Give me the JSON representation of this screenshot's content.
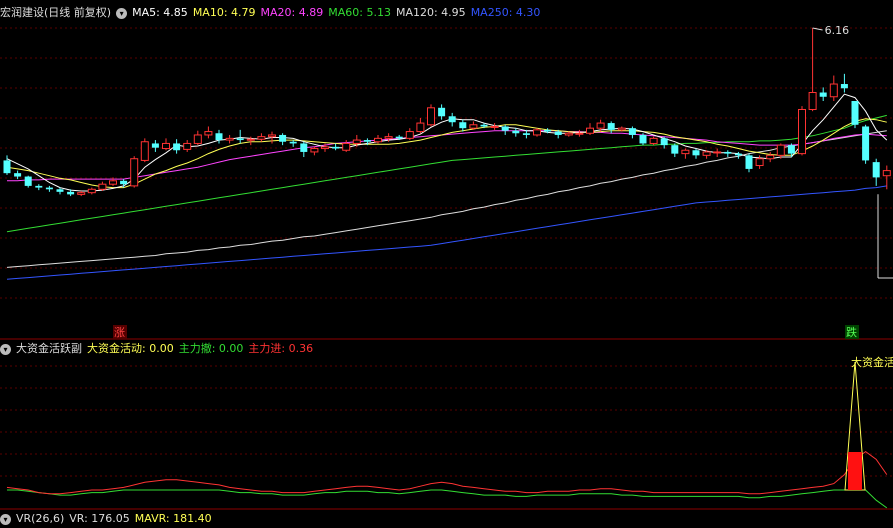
{
  "main_panel": {
    "title": "宏润建设(日线 前复权)",
    "ma_labels": [
      {
        "key": "ma5",
        "text": "MA5: 4.85",
        "color": "#ffffff"
      },
      {
        "key": "ma10",
        "text": "MA10: 4.79",
        "color": "#ffff55"
      },
      {
        "key": "ma20",
        "text": "MA20: 4.89",
        "color": "#ff44ff"
      },
      {
        "key": "ma60",
        "text": "MA60: 5.13",
        "color": "#33dd33"
      },
      {
        "key": "ma120",
        "text": "MA120: 4.95",
        "color": "#dddddd"
      },
      {
        "key": "ma250",
        "text": "MA250: 4.30",
        "color": "#3355ff"
      }
    ],
    "high_marker": "6.16",
    "rise_tag": "涨",
    "fall_tag": "跌"
  },
  "indicator_panel": {
    "title": "大资金活跃副",
    "labels": [
      {
        "key": "active",
        "text": "大资金活动: 0.00",
        "color": "#ffff55"
      },
      {
        "key": "disperse",
        "text": "主力撤: 0.00",
        "color": "#33dd33"
      },
      {
        "key": "enter",
        "text": "主力进: 0.36",
        "color": "#ff3333"
      }
    ],
    "peak_label": "大资金活动"
  },
  "vr_panel": {
    "title": "VR(26,6)",
    "labels": [
      {
        "key": "vr",
        "text": "VR: 176.05",
        "color": "#dddddd"
      },
      {
        "key": "mavr",
        "text": "MAVR: 181.40",
        "color": "#ffff55"
      }
    ]
  },
  "chart_data": {
    "type": "candlestick",
    "title": "宏润建设(日线 前复权)",
    "max_price_marked": 6.16,
    "candles": [
      [
        4.6,
        4.45,
        4.66,
        4.43
      ],
      [
        4.45,
        4.41,
        4.48,
        4.38
      ],
      [
        4.41,
        4.3,
        4.42,
        4.28
      ],
      [
        4.3,
        4.28,
        4.32,
        4.25
      ],
      [
        4.28,
        4.26,
        4.3,
        4.23
      ],
      [
        4.26,
        4.23,
        4.28,
        4.2
      ],
      [
        4.23,
        4.2,
        4.26,
        4.18
      ],
      [
        4.2,
        4.22,
        4.24,
        4.18
      ],
      [
        4.22,
        4.26,
        4.28,
        4.2
      ],
      [
        4.26,
        4.32,
        4.35,
        4.24
      ],
      [
        4.32,
        4.36,
        4.4,
        4.3
      ],
      [
        4.36,
        4.32,
        4.38,
        4.28
      ],
      [
        4.3,
        4.62,
        4.65,
        4.28
      ],
      [
        4.6,
        4.82,
        4.86,
        4.58
      ],
      [
        4.8,
        4.75,
        4.84,
        4.7
      ],
      [
        4.74,
        4.8,
        4.86,
        4.72
      ],
      [
        4.8,
        4.72,
        4.85,
        4.68
      ],
      [
        4.73,
        4.8,
        4.84,
        4.7
      ],
      [
        4.8,
        4.9,
        4.95,
        4.78
      ],
      [
        4.9,
        4.94,
        5.0,
        4.86
      ],
      [
        4.92,
        4.84,
        4.96,
        4.8
      ],
      [
        4.84,
        4.86,
        4.9,
        4.8
      ],
      [
        4.86,
        4.84,
        4.96,
        4.8
      ],
      [
        4.84,
        4.85,
        4.88,
        4.78
      ],
      [
        4.85,
        4.88,
        4.92,
        4.82
      ],
      [
        4.88,
        4.9,
        4.94,
        4.8
      ],
      [
        4.9,
        4.82,
        4.92,
        4.78
      ],
      [
        4.82,
        4.8,
        4.84,
        4.76
      ],
      [
        4.8,
        4.7,
        4.82,
        4.64
      ],
      [
        4.7,
        4.74,
        4.76,
        4.66
      ],
      [
        4.74,
        4.76,
        4.8,
        4.7
      ],
      [
        4.76,
        4.74,
        4.8,
        4.72
      ],
      [
        4.72,
        4.8,
        4.84,
        4.7
      ],
      [
        4.8,
        4.84,
        4.9,
        4.76
      ],
      [
        4.84,
        4.82,
        4.86,
        4.78
      ],
      [
        4.82,
        4.86,
        4.9,
        4.8
      ],
      [
        4.86,
        4.88,
        4.92,
        4.82
      ],
      [
        4.88,
        4.86,
        4.9,
        4.84
      ],
      [
        4.86,
        4.94,
        4.98,
        4.84
      ],
      [
        4.94,
        5.04,
        5.1,
        4.92
      ],
      [
        5.02,
        5.22,
        5.26,
        5.0
      ],
      [
        5.22,
        5.12,
        5.26,
        5.08
      ],
      [
        5.12,
        5.05,
        5.16,
        5.0
      ],
      [
        5.05,
        4.98,
        5.08,
        4.94
      ],
      [
        4.98,
        5.02,
        5.06,
        4.96
      ],
      [
        5.02,
        5.0,
        5.04,
        4.98
      ],
      [
        5.0,
        5.0,
        5.04,
        4.96
      ],
      [
        5.0,
        4.95,
        5.02,
        4.9
      ],
      [
        4.95,
        4.92,
        4.98,
        4.88
      ],
      [
        4.92,
        4.9,
        4.96,
        4.86
      ],
      [
        4.9,
        4.96,
        4.98,
        4.88
      ],
      [
        4.96,
        4.94,
        4.98,
        4.92
      ],
      [
        4.94,
        4.9,
        4.96,
        4.86
      ],
      [
        4.9,
        4.92,
        4.94,
        4.88
      ],
      [
        4.92,
        4.92,
        4.96,
        4.88
      ],
      [
        4.92,
        4.98,
        5.04,
        4.9
      ],
      [
        4.98,
        5.04,
        5.08,
        4.94
      ],
      [
        5.04,
        4.96,
        5.06,
        4.92
      ],
      [
        4.96,
        4.98,
        5.0,
        4.94
      ],
      [
        4.98,
        4.9,
        5.0,
        4.86
      ],
      [
        4.9,
        4.8,
        4.92,
        4.78
      ],
      [
        4.8,
        4.86,
        4.88,
        4.78
      ],
      [
        4.86,
        4.78,
        4.88,
        4.74
      ],
      [
        4.78,
        4.68,
        4.8,
        4.64
      ],
      [
        4.68,
        4.72,
        4.74,
        4.62
      ],
      [
        4.72,
        4.66,
        4.74,
        4.62
      ],
      [
        4.66,
        4.7,
        4.72,
        4.62
      ],
      [
        4.7,
        4.7,
        4.74,
        4.64
      ],
      [
        4.7,
        4.68,
        4.72,
        4.64
      ],
      [
        4.68,
        4.66,
        4.7,
        4.62
      ],
      [
        4.66,
        4.5,
        4.68,
        4.46
      ],
      [
        4.54,
        4.62,
        4.66,
        4.5
      ],
      [
        4.62,
        4.66,
        4.7,
        4.58
      ],
      [
        4.66,
        4.78,
        4.8,
        4.62
      ],
      [
        4.78,
        4.68,
        4.8,
        4.64
      ],
      [
        4.68,
        5.2,
        5.24,
        4.66
      ],
      [
        5.2,
        5.4,
        6.16,
        5.18
      ],
      [
        5.4,
        5.35,
        5.46,
        5.3
      ],
      [
        5.35,
        5.5,
        5.6,
        5.3
      ],
      [
        5.5,
        5.45,
        5.62,
        5.4
      ],
      [
        5.3,
        5.02,
        5.3,
        4.98
      ],
      [
        5.0,
        4.6,
        5.02,
        4.56
      ],
      [
        4.58,
        4.4,
        4.62,
        4.3
      ],
      [
        4.42,
        4.48,
        4.54,
        4.26
      ]
    ],
    "ma5": [
      4.62,
      4.56,
      4.5,
      4.42,
      4.34,
      4.28,
      4.25,
      4.24,
      4.24,
      4.25,
      4.27,
      4.3,
      4.38,
      4.52,
      4.61,
      4.69,
      4.78,
      4.76,
      4.77,
      4.8,
      4.84,
      4.85,
      4.87,
      4.86,
      4.85,
      4.87,
      4.87,
      4.86,
      4.82,
      4.79,
      4.76,
      4.75,
      4.75,
      4.78,
      4.8,
      4.82,
      4.84,
      4.85,
      4.87,
      4.91,
      4.99,
      5.05,
      5.09,
      5.08,
      5.08,
      5.04,
      5.01,
      4.99,
      4.98,
      4.95,
      4.95,
      4.93,
      4.92,
      4.92,
      4.93,
      4.94,
      4.96,
      4.97,
      4.98,
      4.97,
      4.94,
      4.9,
      4.86,
      4.82,
      4.77,
      4.74,
      4.71,
      4.69,
      4.69,
      4.68,
      4.64,
      4.63,
      4.62,
      4.64,
      4.64,
      4.79,
      4.95,
      5.08,
      5.23,
      5.38,
      5.34,
      5.18,
      4.96,
      4.84
    ],
    "ma10": [
      4.52,
      4.5,
      4.48,
      4.45,
      4.42,
      4.39,
      4.37,
      4.34,
      4.31,
      4.29,
      4.28,
      4.28,
      4.32,
      4.38,
      4.44,
      4.48,
      4.53,
      4.57,
      4.62,
      4.68,
      4.73,
      4.77,
      4.8,
      4.82,
      4.82,
      4.83,
      4.84,
      4.84,
      4.83,
      4.82,
      4.81,
      4.8,
      4.79,
      4.79,
      4.79,
      4.79,
      4.79,
      4.8,
      4.82,
      4.84,
      4.87,
      4.9,
      4.93,
      4.95,
      4.97,
      4.99,
      5.0,
      5.02,
      5.02,
      5.0,
      4.98,
      4.96,
      4.95,
      4.94,
      4.93,
      4.93,
      4.94,
      4.95,
      4.95,
      4.95,
      4.94,
      4.93,
      4.91,
      4.88,
      4.86,
      4.84,
      4.82,
      4.79,
      4.77,
      4.74,
      4.71,
      4.69,
      4.67,
      4.66,
      4.66,
      4.71,
      4.77,
      4.84,
      4.92,
      5.0,
      5.06,
      5.09,
      5.08,
      5.05
    ],
    "ma20": [
      4.36,
      4.36,
      4.37,
      4.37,
      4.38,
      4.38,
      4.38,
      4.38,
      4.38,
      4.38,
      4.38,
      4.38,
      4.4,
      4.42,
      4.44,
      4.46,
      4.48,
      4.5,
      4.52,
      4.55,
      4.58,
      4.61,
      4.63,
      4.65,
      4.67,
      4.69,
      4.71,
      4.73,
      4.75,
      4.76,
      4.78,
      4.8,
      4.81,
      4.82,
      4.83,
      4.84,
      4.85,
      4.86,
      4.87,
      4.88,
      4.89,
      4.9,
      4.91,
      4.92,
      4.93,
      4.94,
      4.95,
      4.95,
      4.95,
      4.95,
      4.95,
      4.95,
      4.95,
      4.94,
      4.94,
      4.93,
      4.93,
      4.92,
      4.92,
      4.91,
      4.9,
      4.89,
      4.88,
      4.87,
      4.86,
      4.85,
      4.84,
      4.82,
      4.81,
      4.8,
      4.79,
      4.78,
      4.78,
      4.78,
      4.78,
      4.79,
      4.81,
      4.83,
      4.86,
      4.88,
      4.9,
      4.91,
      4.9,
      4.89
    ],
    "ma60": [
      3.76,
      3.78,
      3.8,
      3.82,
      3.84,
      3.86,
      3.88,
      3.9,
      3.92,
      3.94,
      3.96,
      3.98,
      4.0,
      4.02,
      4.04,
      4.06,
      4.08,
      4.1,
      4.12,
      4.14,
      4.16,
      4.18,
      4.2,
      4.22,
      4.24,
      4.26,
      4.28,
      4.3,
      4.32,
      4.34,
      4.36,
      4.38,
      4.4,
      4.42,
      4.44,
      4.46,
      4.48,
      4.5,
      4.52,
      4.54,
      4.56,
      4.58,
      4.6,
      4.61,
      4.62,
      4.63,
      4.64,
      4.65,
      4.66,
      4.67,
      4.68,
      4.69,
      4.7,
      4.71,
      4.72,
      4.73,
      4.74,
      4.75,
      4.76,
      4.77,
      4.78,
      4.78,
      4.79,
      4.79,
      4.8,
      4.8,
      4.81,
      4.81,
      4.82,
      4.82,
      4.82,
      4.83,
      4.83,
      4.84,
      4.85,
      4.87,
      4.89,
      4.92,
      4.95,
      4.98,
      5.03,
      5.07,
      5.1,
      5.13
    ],
    "ma120": [
      3.34,
      3.35,
      3.36,
      3.37,
      3.38,
      3.39,
      3.4,
      3.41,
      3.42,
      3.43,
      3.44,
      3.45,
      3.46,
      3.47,
      3.48,
      3.5,
      3.51,
      3.52,
      3.54,
      3.55,
      3.57,
      3.58,
      3.6,
      3.61,
      3.63,
      3.65,
      3.66,
      3.68,
      3.7,
      3.71,
      3.73,
      3.75,
      3.77,
      3.79,
      3.81,
      3.83,
      3.85,
      3.87,
      3.89,
      3.91,
      3.93,
      3.96,
      3.98,
      4.0,
      4.03,
      4.05,
      4.08,
      4.1,
      4.13,
      4.15,
      4.18,
      4.2,
      4.23,
      4.25,
      4.28,
      4.3,
      4.33,
      4.35,
      4.38,
      4.4,
      4.43,
      4.45,
      4.48,
      4.5,
      4.53,
      4.55,
      4.58,
      4.6,
      4.63,
      4.65,
      4.68,
      4.7,
      4.72,
      4.75,
      4.77,
      4.79,
      4.81,
      4.83,
      4.85,
      4.87,
      4.89,
      4.91,
      4.93,
      4.95
    ],
    "ma250": [
      3.2,
      3.21,
      3.22,
      3.23,
      3.24,
      3.25,
      3.26,
      3.27,
      3.28,
      3.29,
      3.3,
      3.31,
      3.32,
      3.33,
      3.34,
      3.35,
      3.36,
      3.37,
      3.38,
      3.39,
      3.4,
      3.41,
      3.42,
      3.43,
      3.44,
      3.45,
      3.46,
      3.47,
      3.48,
      3.49,
      3.5,
      3.51,
      3.52,
      3.53,
      3.54,
      3.55,
      3.56,
      3.57,
      3.58,
      3.59,
      3.6,
      3.62,
      3.64,
      3.66,
      3.68,
      3.7,
      3.72,
      3.74,
      3.76,
      3.78,
      3.8,
      3.82,
      3.84,
      3.86,
      3.88,
      3.9,
      3.92,
      3.94,
      3.96,
      3.98,
      4.0,
      4.02,
      4.04,
      4.06,
      4.08,
      4.1,
      4.11,
      4.12,
      4.13,
      4.14,
      4.15,
      4.16,
      4.17,
      4.18,
      4.19,
      4.2,
      4.21,
      4.22,
      4.23,
      4.24,
      4.25,
      4.27,
      4.28,
      4.3
    ],
    "indicator": {
      "active_peak": 1.0,
      "active_peak_index": 80,
      "enter_peak_index": 80,
      "red_line": [
        0.02,
        0.01,
        0.0,
        -0.02,
        -0.03,
        -0.03,
        -0.02,
        -0.01,
        0.0,
        0.0,
        0.01,
        0.02,
        0.04,
        0.06,
        0.07,
        0.08,
        0.08,
        0.07,
        0.06,
        0.05,
        0.04,
        0.02,
        0.01,
        0.0,
        -0.01,
        -0.01,
        -0.02,
        -0.02,
        -0.02,
        -0.01,
        0.0,
        0.01,
        0.02,
        0.03,
        0.03,
        0.02,
        0.01,
        0.0,
        0.01,
        0.03,
        0.05,
        0.06,
        0.05,
        0.03,
        0.02,
        0.01,
        0.0,
        -0.01,
        -0.01,
        -0.02,
        -0.02,
        -0.01,
        -0.01,
        -0.01,
        0.0,
        0.0,
        0.01,
        0.01,
        0.0,
        -0.01,
        -0.01,
        -0.02,
        -0.02,
        -0.02,
        -0.02,
        -0.02,
        -0.02,
        -0.02,
        -0.02,
        -0.02,
        -0.03,
        -0.03,
        -0.02,
        -0.01,
        0.0,
        0.01,
        0.02,
        0.03,
        0.05,
        0.12,
        0.24,
        0.3,
        0.24,
        0.12
      ],
      "green_line": [
        0.0,
        0.0,
        -0.01,
        -0.02,
        -0.03,
        -0.04,
        -0.04,
        -0.03,
        -0.02,
        -0.02,
        -0.01,
        0.0,
        0.0,
        0.0,
        0.0,
        0.0,
        0.0,
        0.0,
        0.0,
        0.0,
        0.0,
        -0.01,
        -0.02,
        -0.02,
        -0.03,
        -0.03,
        -0.04,
        -0.04,
        -0.04,
        -0.03,
        -0.02,
        -0.02,
        -0.01,
        -0.01,
        -0.01,
        -0.02,
        -0.02,
        -0.03,
        -0.02,
        -0.01,
        0.0,
        0.0,
        -0.01,
        -0.02,
        -0.03,
        -0.04,
        -0.04,
        -0.04,
        -0.05,
        -0.05,
        -0.04,
        -0.04,
        -0.04,
        -0.04,
        -0.03,
        -0.03,
        -0.03,
        -0.03,
        -0.04,
        -0.04,
        -0.05,
        -0.05,
        -0.05,
        -0.05,
        -0.05,
        -0.05,
        -0.05,
        -0.05,
        -0.05,
        -0.05,
        -0.06,
        -0.06,
        -0.05,
        -0.05,
        -0.04,
        -0.03,
        -0.02,
        -0.01,
        0.0,
        0.0,
        0.0,
        0.0,
        -0.08,
        -0.14
      ]
    }
  }
}
